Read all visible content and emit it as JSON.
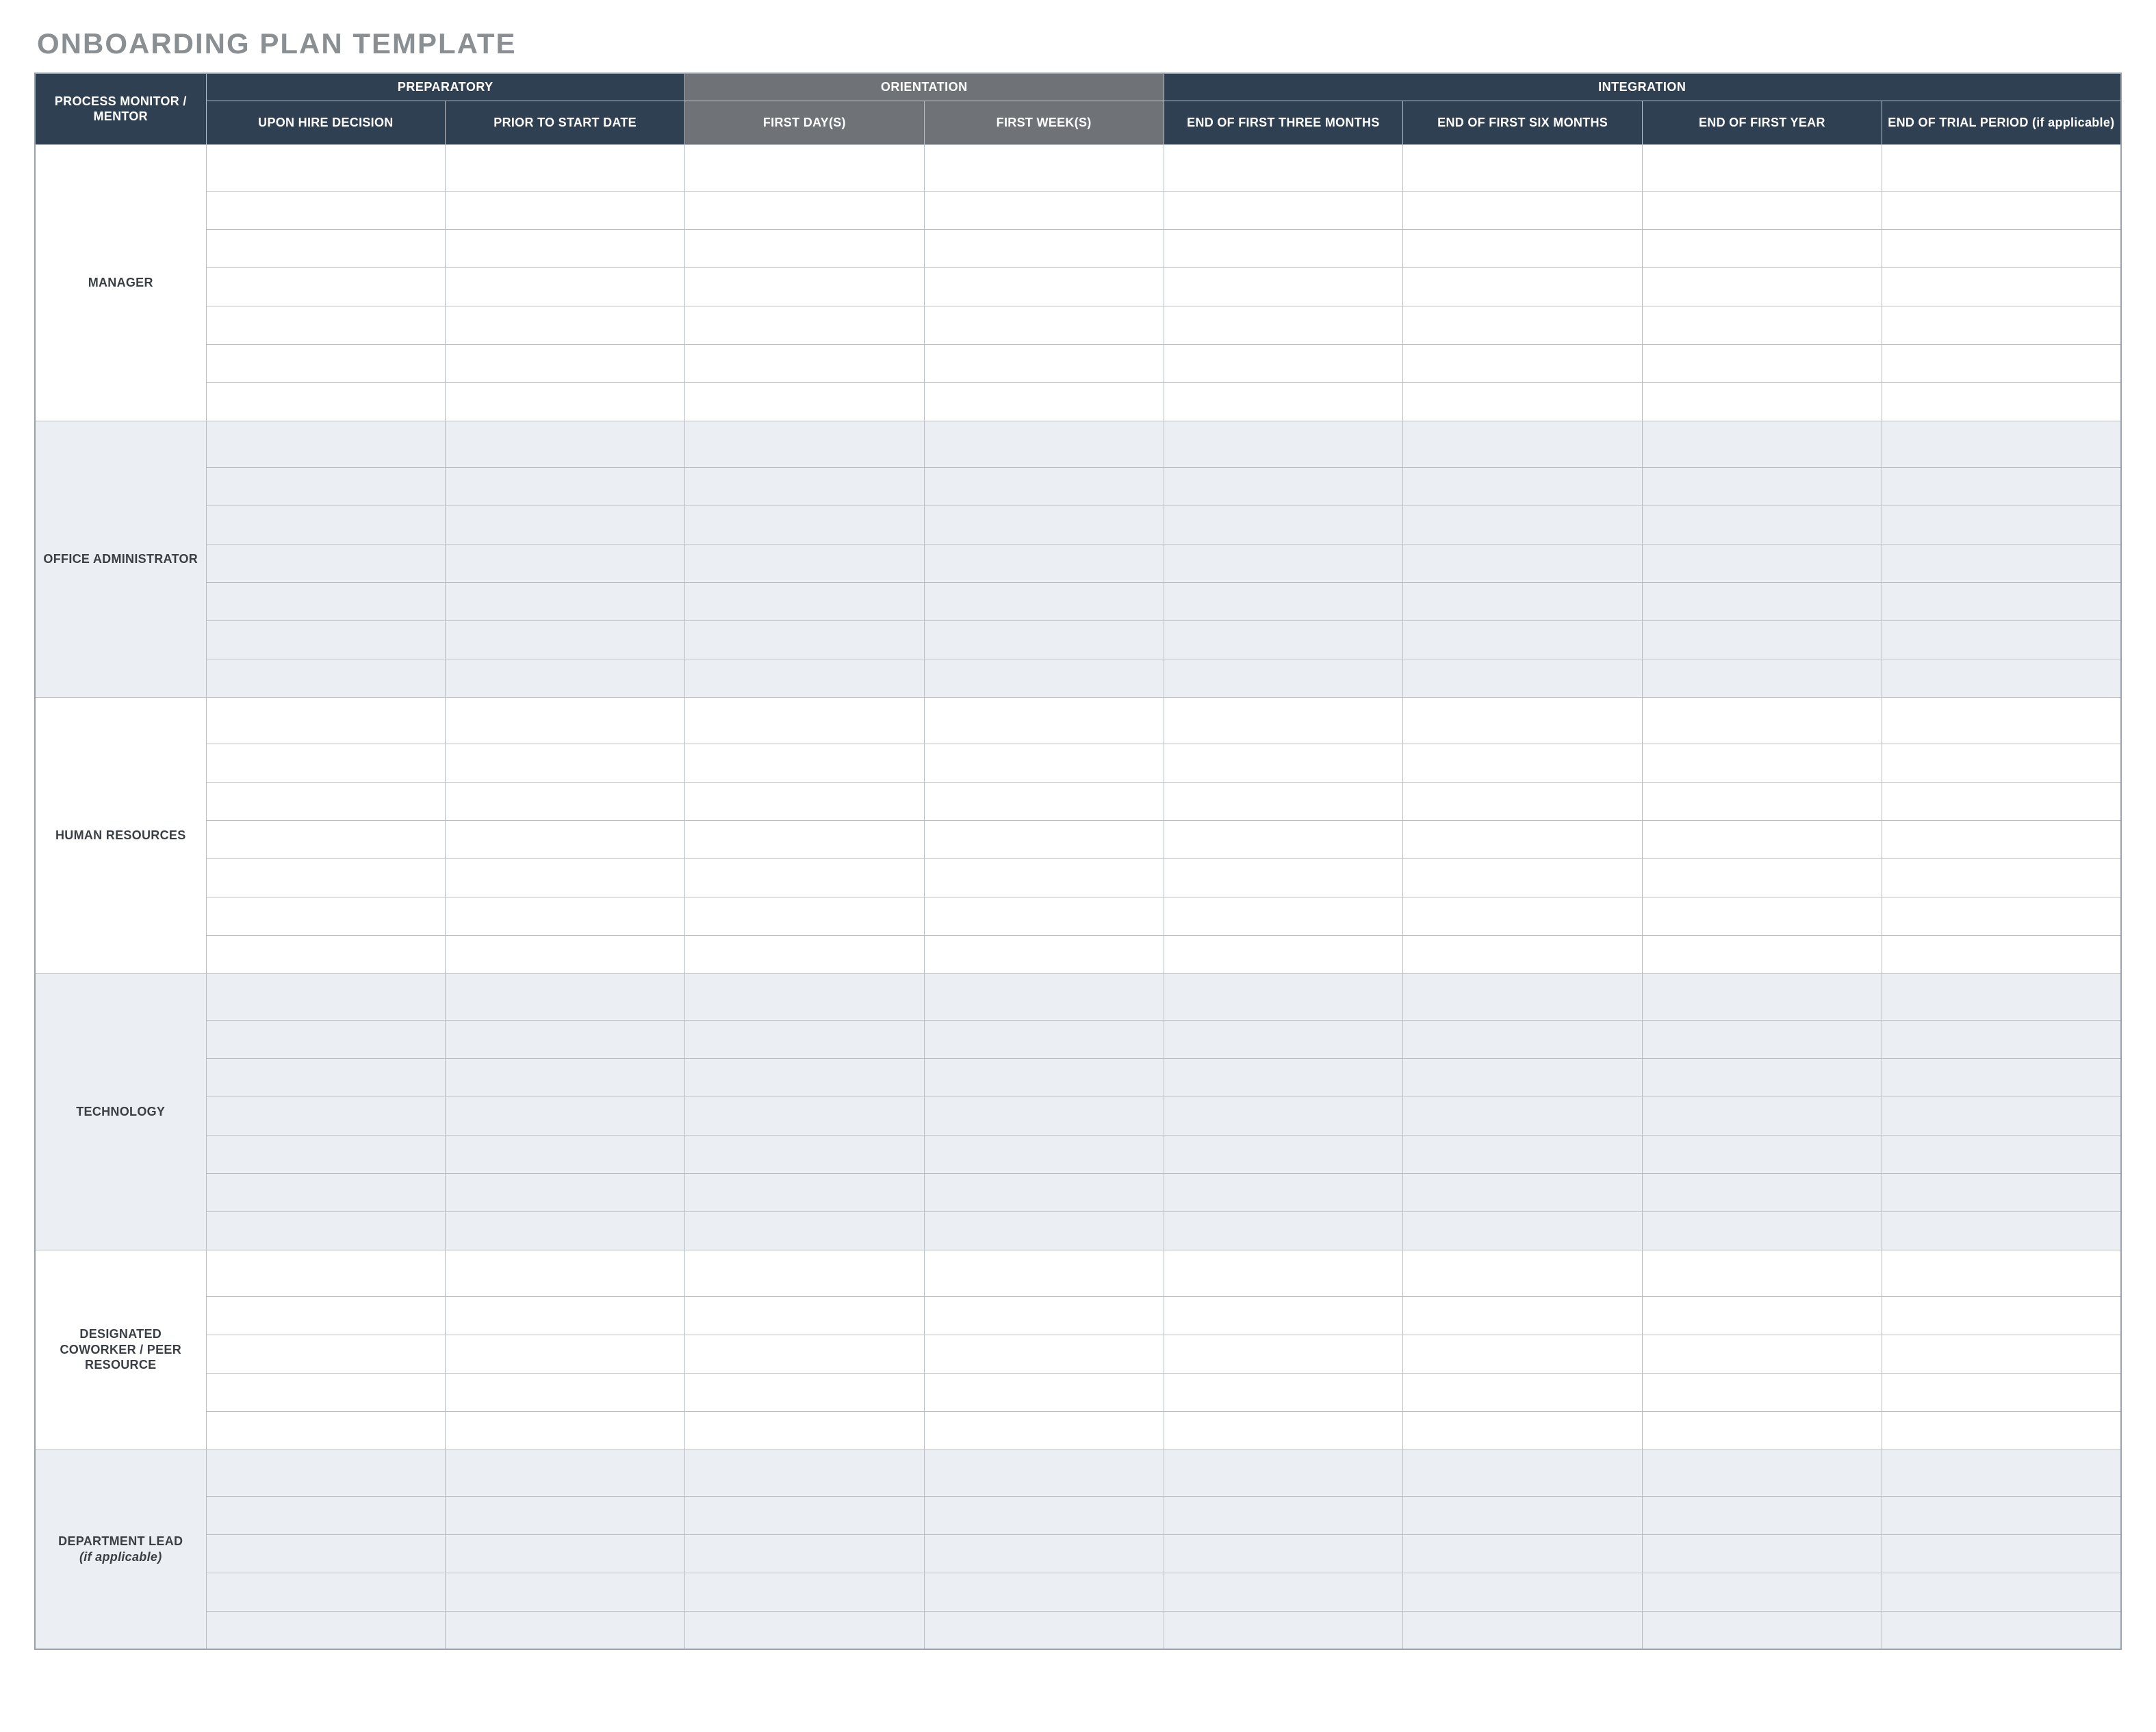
{
  "title": "ONBOARDING PLAN TEMPLATE",
  "corner": "PROCESS MONITOR / MENTOR",
  "groups": {
    "preparatory": "PREPARATORY",
    "orientation": "ORIENTATION",
    "integration": "INTEGRATION"
  },
  "columns": {
    "upon_hire": "UPON HIRE DECISION",
    "prior_start": "PRIOR TO START DATE",
    "first_days": "FIRST DAY(S)",
    "first_weeks": "FIRST WEEK(S)",
    "end_three_months": "END OF FIRST THREE MONTHS",
    "end_six_months": "END OF FIRST SIX MONTHS",
    "end_first_year": "END OF FIRST YEAR",
    "end_trial": "END OF TRIAL PERIOD (if applicable)"
  },
  "row_groups": [
    {
      "label": "MANAGER",
      "rows": 7,
      "band": "white"
    },
    {
      "label": "OFFICE ADMINISTRATOR",
      "rows": 7,
      "band": "grey"
    },
    {
      "label": "HUMAN RESOURCES",
      "rows": 7,
      "band": "white"
    },
    {
      "label": "TECHNOLOGY",
      "rows": 7,
      "band": "grey"
    },
    {
      "label": "DESIGNATED COWORKER / PEER RESOURCE",
      "rows": 5,
      "band": "white"
    },
    {
      "label": "DEPARTMENT LEAD (if applicable)",
      "rows": 5,
      "band": "grey"
    }
  ]
}
